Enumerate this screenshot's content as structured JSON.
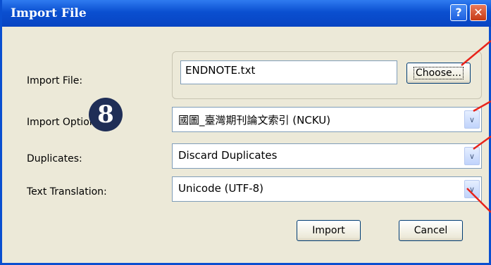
{
  "window": {
    "title": "Import File",
    "help_glyph": "?",
    "close_glyph": "✕"
  },
  "form": {
    "import_file_label": "Import File:",
    "import_file_value": "ENDNOTE.txt",
    "choose_label": "Choose...",
    "import_option_label": "Import Option:",
    "import_option_value": "國圖_臺灣期刊論文索引 (NCKU)",
    "duplicates_label": "Duplicates:",
    "duplicates_value": "Discard Duplicates",
    "text_translation_label": "Text Translation:",
    "text_translation_value": "Unicode (UTF-8)",
    "dropdown_arrow": "∨"
  },
  "buttons": {
    "import_label": "Import",
    "cancel_label": "Cancel"
  },
  "annotation": {
    "step_number": "8",
    "callout_color": "#e8231a"
  }
}
